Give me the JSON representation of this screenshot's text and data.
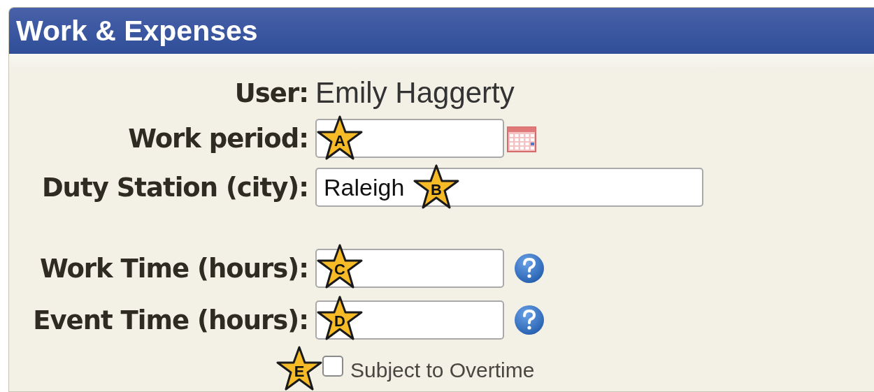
{
  "panel": {
    "title": "Work & Expenses"
  },
  "rows": [
    {
      "kind": "text",
      "label": "User:",
      "value": "Emily Haggerty"
    },
    {
      "kind": "date",
      "label": "Work period:",
      "callout": "A"
    },
    {
      "kind": "city",
      "label": "Duty Station (city):",
      "value": "Raleigh",
      "callout": "B"
    },
    {
      "kind": "spacer"
    },
    {
      "kind": "hours",
      "label": "Work Time (hours):",
      "callout": "C"
    },
    {
      "kind": "hours",
      "label": "Event Time (hours):",
      "callout": "D"
    },
    {
      "kind": "checkbox",
      "label": "Subject to Overtime",
      "checked": false,
      "callout": "E"
    }
  ]
}
